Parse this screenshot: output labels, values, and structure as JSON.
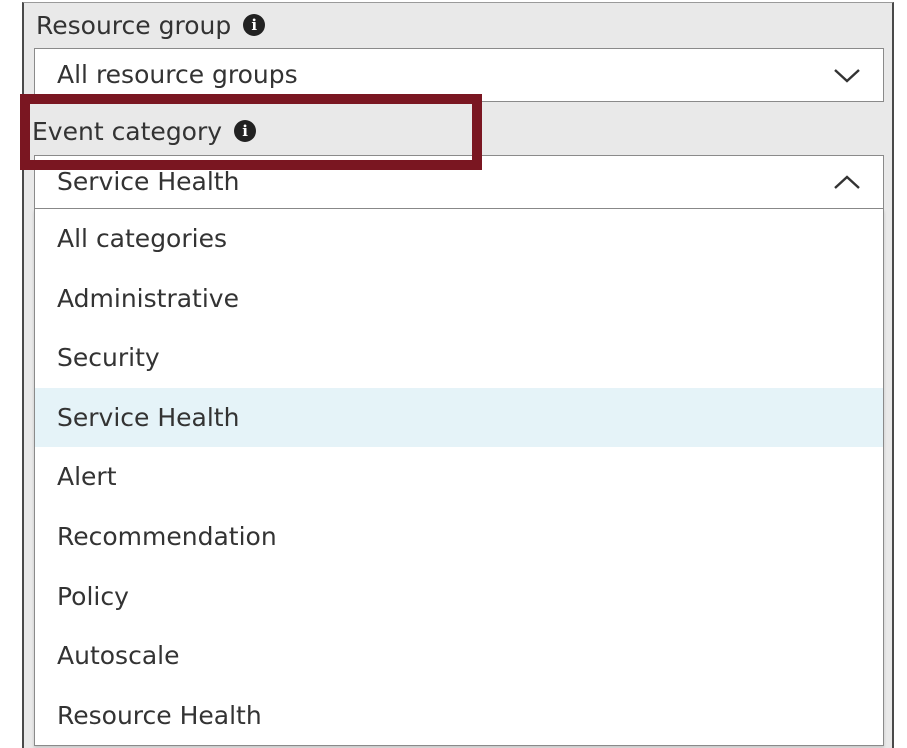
{
  "resource_group": {
    "label": "Resource group",
    "info_icon": "info-icon",
    "value": "All resource groups",
    "chevron": "chevron-down-icon"
  },
  "event_category": {
    "label": "Event category",
    "info_icon": "info-icon",
    "value": "Service Health",
    "chevron": "chevron-up-icon",
    "options": [
      "All categories",
      "Administrative",
      "Security",
      "Service Health",
      "Alert",
      "Recommendation",
      "Policy",
      "Autoscale",
      "Resource Health"
    ],
    "selected_option": "Service Health"
  },
  "annotation": {
    "highlight_color": "#7a1621",
    "highlight_target": "event-category-label"
  }
}
